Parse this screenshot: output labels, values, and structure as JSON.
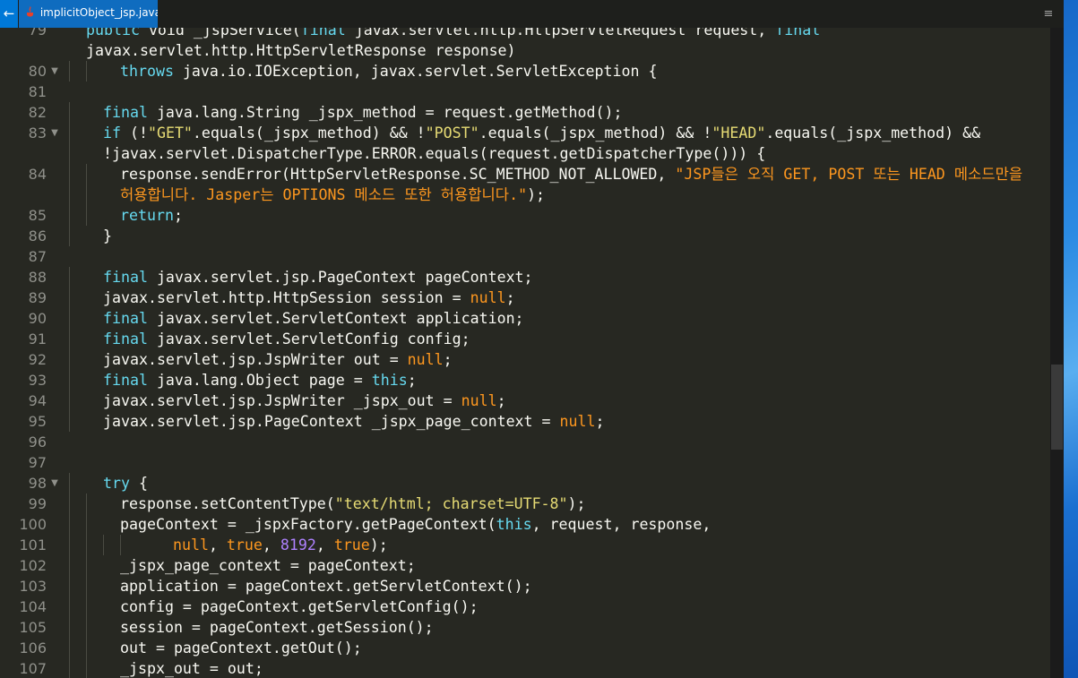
{
  "tab": {
    "back_label": "←",
    "title": "implicitObject_jsp.java",
    "menu_label": "≡"
  },
  "editor": {
    "lines": [
      {
        "num": "79",
        "fold": "",
        "indent": 1,
        "cont": false,
        "tokens": [
          [
            "kw",
            "public"
          ],
          [
            "",
            " void _jspService("
          ],
          [
            "kw",
            "final"
          ],
          [
            "",
            " javax.servlet.http.HttpServletRequest request, "
          ],
          [
            "kw",
            "final"
          ]
        ]
      },
      {
        "num": "",
        "fold": "",
        "indent": 1,
        "cont": true,
        "tokens": [
          [
            "",
            "javax.servlet.http.HttpServletResponse response)"
          ]
        ]
      },
      {
        "num": "80",
        "fold": "▼",
        "indent": 3,
        "cont": false,
        "tokens": [
          [
            "kw",
            "throws"
          ],
          [
            "",
            " java.io.IOException, javax.servlet.ServletException {"
          ]
        ]
      },
      {
        "num": "81",
        "fold": "",
        "indent": 0,
        "cont": false,
        "tokens": []
      },
      {
        "num": "82",
        "fold": "",
        "indent": 2,
        "cont": false,
        "tokens": [
          [
            "kw",
            "final"
          ],
          [
            "",
            " java.lang.String _jspx_method = request.getMethod();"
          ]
        ]
      },
      {
        "num": "83",
        "fold": "▼",
        "indent": 2,
        "cont": false,
        "tokens": [
          [
            "kw",
            "if"
          ],
          [
            "",
            " (!"
          ],
          [
            "str",
            "\"GET\""
          ],
          [
            "",
            ".equals(_jspx_method) && !"
          ],
          [
            "str",
            "\"POST\""
          ],
          [
            "",
            ".equals(_jspx_method) && !"
          ],
          [
            "str",
            "\"HEAD\""
          ],
          [
            "",
            ".equals(_jspx_method) &&"
          ]
        ]
      },
      {
        "num": "",
        "fold": "",
        "indent": 2,
        "cont": true,
        "tokens": [
          [
            "",
            "!javax.servlet.DispatcherType.ERROR.equals(request.getDispatcherType())) {"
          ]
        ]
      },
      {
        "num": "84",
        "fold": "",
        "indent": 3,
        "cont": false,
        "tokens": [
          [
            "",
            "response.sendError(HttpServletResponse.SC_METHOD_NOT_ALLOWED, "
          ],
          [
            "str2",
            "\"JSP들은 오직 GET, POST 또는 HEAD 메소드만을"
          ]
        ]
      },
      {
        "num": "",
        "fold": "",
        "indent": 3,
        "cont": true,
        "tokens": [
          [
            "str2",
            "허용합니다. Jasper는 OPTIONS 메소드 또한 허용합니다.\""
          ],
          [
            "",
            ");"
          ]
        ]
      },
      {
        "num": "85",
        "fold": "",
        "indent": 3,
        "cont": false,
        "tokens": [
          [
            "kw",
            "return"
          ],
          [
            "",
            ";"
          ]
        ]
      },
      {
        "num": "86",
        "fold": "",
        "indent": 2,
        "cont": false,
        "tokens": [
          [
            "",
            "}"
          ]
        ]
      },
      {
        "num": "87",
        "fold": "",
        "indent": 0,
        "cont": false,
        "tokens": []
      },
      {
        "num": "88",
        "fold": "",
        "indent": 2,
        "cont": false,
        "tokens": [
          [
            "kw",
            "final"
          ],
          [
            "",
            " javax.servlet.jsp.PageContext pageContext;"
          ]
        ]
      },
      {
        "num": "89",
        "fold": "",
        "indent": 2,
        "cont": false,
        "tokens": [
          [
            "",
            "javax.servlet.http.HttpSession session = "
          ],
          [
            "null",
            "null"
          ],
          [
            "",
            ";"
          ]
        ]
      },
      {
        "num": "90",
        "fold": "",
        "indent": 2,
        "cont": false,
        "tokens": [
          [
            "kw",
            "final"
          ],
          [
            "",
            " javax.servlet.ServletContext application;"
          ]
        ]
      },
      {
        "num": "91",
        "fold": "",
        "indent": 2,
        "cont": false,
        "tokens": [
          [
            "kw",
            "final"
          ],
          [
            "",
            " javax.servlet.ServletConfig config;"
          ]
        ]
      },
      {
        "num": "92",
        "fold": "",
        "indent": 2,
        "cont": false,
        "tokens": [
          [
            "",
            "javax.servlet.jsp.JspWriter out = "
          ],
          [
            "null",
            "null"
          ],
          [
            "",
            ";"
          ]
        ]
      },
      {
        "num": "93",
        "fold": "",
        "indent": 2,
        "cont": false,
        "tokens": [
          [
            "kw",
            "final"
          ],
          [
            "",
            " java.lang.Object page = "
          ],
          [
            "kw",
            "this"
          ],
          [
            "",
            ";"
          ]
        ]
      },
      {
        "num": "94",
        "fold": "",
        "indent": 2,
        "cont": false,
        "tokens": [
          [
            "",
            "javax.servlet.jsp.JspWriter _jspx_out = "
          ],
          [
            "null",
            "null"
          ],
          [
            "",
            ";"
          ]
        ]
      },
      {
        "num": "95",
        "fold": "",
        "indent": 2,
        "cont": false,
        "tokens": [
          [
            "",
            "javax.servlet.jsp.PageContext _jspx_page_context = "
          ],
          [
            "null",
            "null"
          ],
          [
            "",
            ";"
          ]
        ]
      },
      {
        "num": "96",
        "fold": "",
        "indent": 0,
        "cont": false,
        "tokens": []
      },
      {
        "num": "97",
        "fold": "",
        "indent": 0,
        "cont": false,
        "tokens": []
      },
      {
        "num": "98",
        "fold": "▼",
        "indent": 2,
        "cont": false,
        "tokens": [
          [
            "kw",
            "try"
          ],
          [
            "",
            " {"
          ]
        ]
      },
      {
        "num": "99",
        "fold": "",
        "indent": 3,
        "cont": false,
        "tokens": [
          [
            "",
            "response.setContentType("
          ],
          [
            "str",
            "\"text/html; charset=UTF-8\""
          ],
          [
            "",
            ");"
          ]
        ]
      },
      {
        "num": "100",
        "fold": "",
        "indent": 3,
        "cont": false,
        "tokens": [
          [
            "",
            "pageContext = _jspxFactory.getPageContext("
          ],
          [
            "kw",
            "this"
          ],
          [
            "",
            ", request, response,"
          ]
        ]
      },
      {
        "num": "101",
        "fold": "",
        "indent": 5,
        "cont": false,
        "tokens": [
          [
            "",
            "    "
          ],
          [
            "null",
            "null"
          ],
          [
            "",
            ", "
          ],
          [
            "null",
            "true"
          ],
          [
            "",
            ", "
          ],
          [
            "num",
            "8192"
          ],
          [
            "",
            ", "
          ],
          [
            "null",
            "true"
          ],
          [
            "",
            ");"
          ]
        ]
      },
      {
        "num": "102",
        "fold": "",
        "indent": 3,
        "cont": false,
        "tokens": [
          [
            "",
            "_jspx_page_context = pageContext;"
          ]
        ]
      },
      {
        "num": "103",
        "fold": "",
        "indent": 3,
        "cont": false,
        "tokens": [
          [
            "",
            "application = pageContext.getServletContext();"
          ]
        ]
      },
      {
        "num": "104",
        "fold": "",
        "indent": 3,
        "cont": false,
        "tokens": [
          [
            "",
            "config = pageContext.getServletConfig();"
          ]
        ]
      },
      {
        "num": "105",
        "fold": "",
        "indent": 3,
        "cont": false,
        "tokens": [
          [
            "",
            "session = pageContext.getSession();"
          ]
        ]
      },
      {
        "num": "106",
        "fold": "",
        "indent": 3,
        "cont": false,
        "tokens": [
          [
            "",
            "out = pageContext.getOut();"
          ]
        ]
      },
      {
        "num": "107",
        "fold": "",
        "indent": 3,
        "cont": false,
        "tokens": [
          [
            "",
            "_jspx_out = out;"
          ]
        ]
      }
    ]
  },
  "colors": {
    "background": "#272822",
    "keyword": "#66d9ef",
    "string": "#e6db74",
    "korean_string": "#fd971f",
    "number": "#ae81ff",
    "tab_active": "#0f6cbf"
  }
}
